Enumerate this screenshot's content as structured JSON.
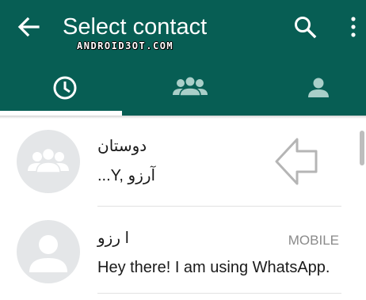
{
  "header": {
    "title": "Select contact",
    "watermark": "ANDROID3OT.COM",
    "back_icon": "arrow-back-icon",
    "search_icon": "search-icon",
    "menu_icon": "more-vertical-icon",
    "background": "#075e54"
  },
  "tabs": [
    {
      "icon": "clock-icon",
      "selected": true
    },
    {
      "icon": "group-icon",
      "selected": false
    },
    {
      "icon": "person-icon",
      "selected": false
    }
  ],
  "contacts": [
    {
      "name": "دوستان",
      "subtitle": "...Y, آرزو",
      "avatar_icon": "group-avatar-icon",
      "phone_type": ""
    },
    {
      "name": "ا رزو",
      "subtitle": "Hey there! I am using WhatsApp.",
      "avatar_icon": "person-avatar-icon",
      "phone_type": "MOBILE"
    }
  ],
  "annotation": {
    "icon": "pointer-arrow-left-icon"
  }
}
